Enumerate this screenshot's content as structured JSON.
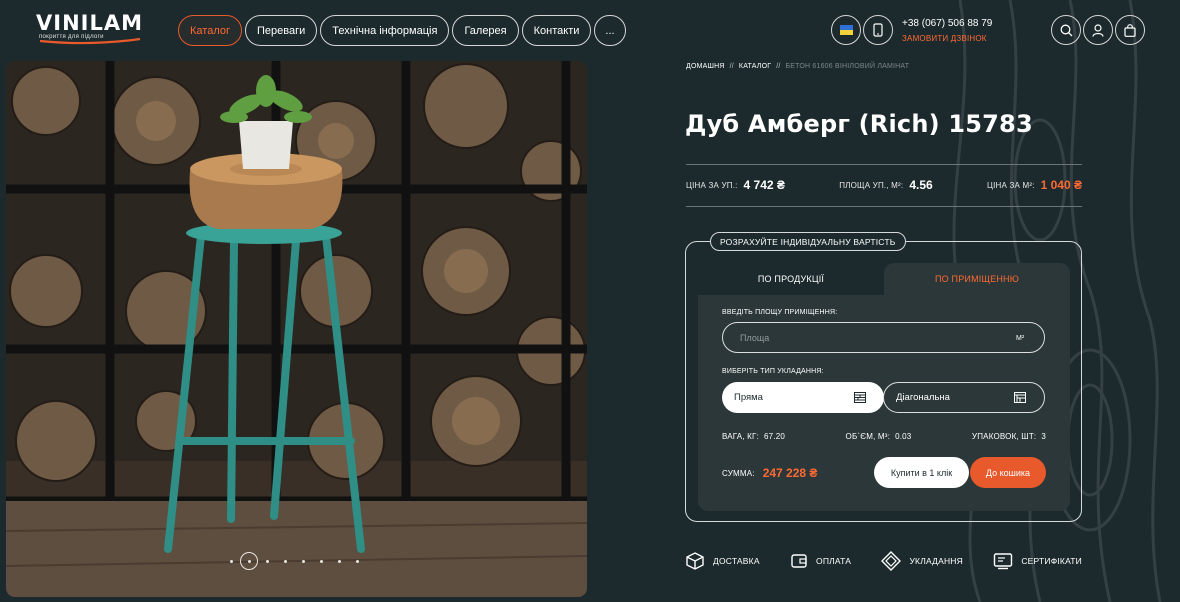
{
  "brand": {
    "logo": "VINILAM",
    "tagline": "покриття для підлоги"
  },
  "nav": {
    "items": [
      "Каталог",
      "Переваги",
      "Технічна інформація",
      "Галерея",
      "Контакти",
      "..."
    ]
  },
  "header": {
    "phone": "+38 (067) 506 88 79",
    "callback": "ЗАМОВИТИ ДЗВІНОК"
  },
  "breadcrumb": {
    "home": "ДОМАШНЯ",
    "catalog": "КАТАЛОГ",
    "separator": "//",
    "current": "БЕТОН 61606 ВІНІЛОВИЙ ЛАМІНАТ"
  },
  "product": {
    "title": "Дуб Амберг (Rich) 15783",
    "price_label": "ЦІНА ЗА УП.:",
    "price_value": "4 742 ₴",
    "area_label": "ПЛОЩА УП., М²:",
    "area_value": "4.56",
    "price_m2_label": "ЦІНА ЗА М²:",
    "price_m2_value": "1 040 ₴"
  },
  "calculator": {
    "title": "РОЗРАХУЙТЕ ІНДИВІДУАЛЬНУ ВАРТІСТЬ",
    "tab_product": "ПО ПРОДУКЦІЇ",
    "tab_room": "ПО ПРИМІЩЕННЮ",
    "area_label": "ВВЕДІТЬ ПЛОЩУ ПРИМІЩЕННЯ:",
    "area_placeholder": "Площа",
    "area_value": "",
    "unit": "М²",
    "laying_label": "ВИБЕРІТЬ ТИП УКЛАДАННЯ:",
    "laying_straight": "Пряма",
    "laying_diagonal": "Діагональна",
    "weight_label": "ВАГА, КГ:",
    "weight_value": "67.20",
    "volume_label": "ОБ`ЄМ, М³:",
    "volume_value": "0.03",
    "packs_label": "УПАКОВОК, ШТ:",
    "packs_value": "3",
    "sum_label": "СУММА:",
    "sum_value": "247 228 ₴",
    "buy_one_click": "Купити в 1 клік",
    "add_to_cart": "До кошика"
  },
  "features": [
    "ДОСТАВКА",
    "ОПЛАТА",
    "УКЛАДАННЯ",
    "СЕРТИФІКАТИ"
  ],
  "gallery": {
    "slides": 8,
    "active_slide": 2
  },
  "colors": {
    "background": "#1d2a2d",
    "panel": "#2b3739",
    "accent": "#e8592b",
    "accent_text": "#ff6a34"
  }
}
